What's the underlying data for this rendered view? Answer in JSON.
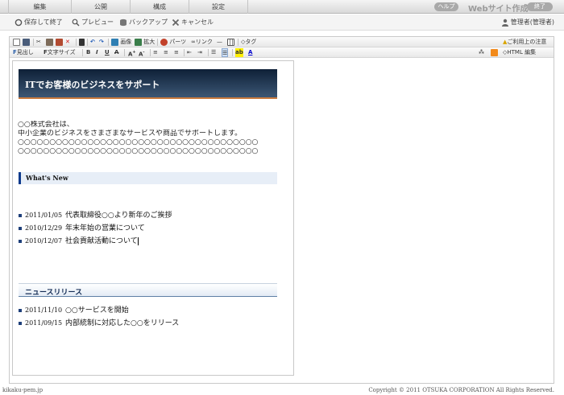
{
  "tabs": [
    "編集",
    "公開",
    "構成",
    "設定"
  ],
  "header": {
    "help_label": "ヘルプ",
    "brand": "Webサイト作成",
    "close_label": "終了"
  },
  "actions": {
    "save_exit": "保存して終了",
    "preview": "プレビュー",
    "backup": "バックアップ",
    "cancel": "キャンセル",
    "user": "管理者(管理者)"
  },
  "toolbar": {
    "image": "画像",
    "zoom": "拡大",
    "parts": "パーツ",
    "link": "リンク",
    "tag": "タグ",
    "notice": "ご利用上の注意",
    "heading": "見出し",
    "font_size": "文字サイズ",
    "bold": "B",
    "italic": "I",
    "underline": "U",
    "strike": "A",
    "font_up": "A",
    "font_down": "A",
    "bg_color": "ab",
    "fg_color": "A",
    "html_edit": "HTML 編集"
  },
  "colors": {
    "banner_dark": "#0e2037",
    "banner_light": "#3c5674",
    "accent": "#c97a3e",
    "bullet": "#1e3f7a"
  },
  "page": {
    "banner_title": "ITでお客様のビジネスをサポート",
    "intro_lines": [
      "○○株式会社は、",
      "中小企業のビジネスをさまざまなサービスや商品でサポートします。",
      "○○○○○○○○○○○○○○○○○○○○○○○○○○○○○○○○○○○○○○",
      "○○○○○○○○○○○○○○○○○○○○○○○○○○○○○○○○○○○○○○"
    ],
    "whats_new_title": "What's New",
    "whats_new": [
      {
        "date": "2011/01/05",
        "text": "代表取締役○○より新年のご挨拶"
      },
      {
        "date": "2010/12/29",
        "text": "年末年始の営業について"
      },
      {
        "date": "2010/12/07",
        "text": "社会貢献活動について"
      }
    ],
    "release_title": "ニュースリリース",
    "releases": [
      {
        "date": "2011/11/10",
        "text": "○○サービスを開始"
      },
      {
        "date": "2011/09/15",
        "text": "内部統制に対応した○○をリリース"
      }
    ]
  },
  "footer": {
    "left": "kikaku-pem.jp",
    "right": "Copyright © 2011 OTSUKA CORPORATION All Rights Reserved."
  }
}
